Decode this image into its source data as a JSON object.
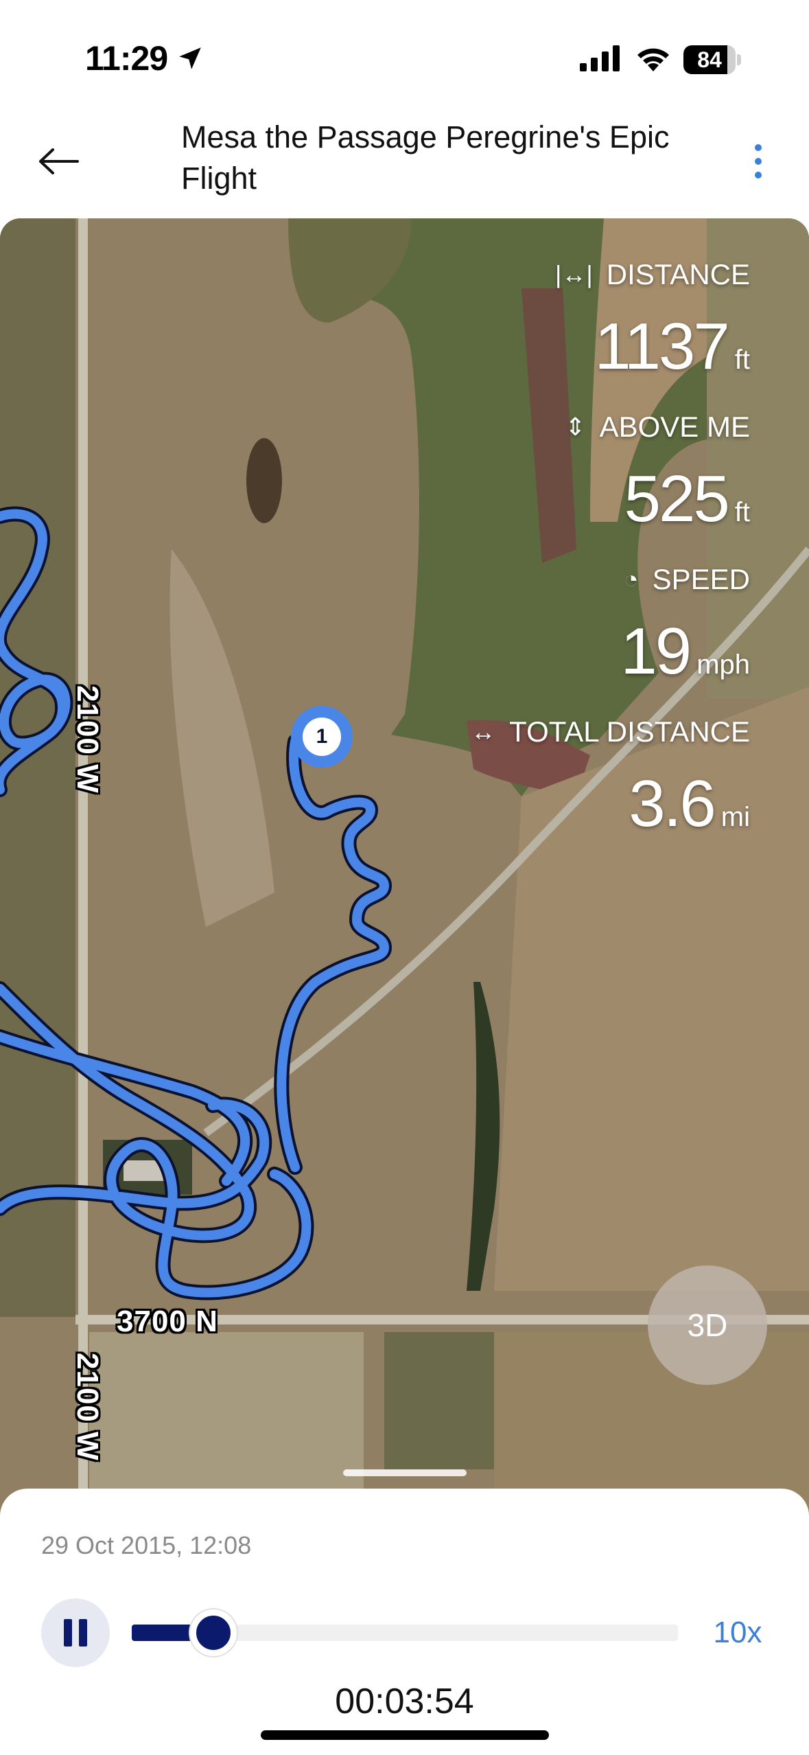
{
  "status_bar": {
    "time": "11:29",
    "battery_level": "84",
    "battery_fraction": 0.84,
    "icons": [
      "location-arrow-icon",
      "cellular-signal-icon",
      "wifi-icon",
      "battery-icon"
    ]
  },
  "header": {
    "back_icon": "arrow-left-icon",
    "title": "Mesa the Passage Peregrine's Epic Flight",
    "more_icon": "vertical-ellipsis-icon",
    "accent_color": "#3c7fd8"
  },
  "map": {
    "road_labels": [
      "2100 W",
      "3700 N",
      "2100 W"
    ],
    "marker_label": "1",
    "track_color": "#4a86e8",
    "stats": [
      {
        "icon": "distance-icon",
        "label": "DISTANCE",
        "value": "1137",
        "unit": "ft"
      },
      {
        "icon": "altitude-icon",
        "label": "ABOVE ME",
        "value": "525",
        "unit": "ft"
      },
      {
        "icon": "speedometer-icon",
        "label": "SPEED",
        "value": "19",
        "unit": "mph"
      },
      {
        "icon": "total-distance-icon",
        "label": "TOTAL DISTANCE",
        "value": "3.6",
        "unit": "mi"
      }
    ],
    "view_toggle_label": "3D"
  },
  "playback": {
    "date_time": "29 Oct 2015, 12:08",
    "pause_icon": "pause-icon",
    "progress_fraction": 0.15,
    "speed_label": "10x",
    "elapsed": "00:03:54",
    "progress_color": "#0c1a6e"
  }
}
